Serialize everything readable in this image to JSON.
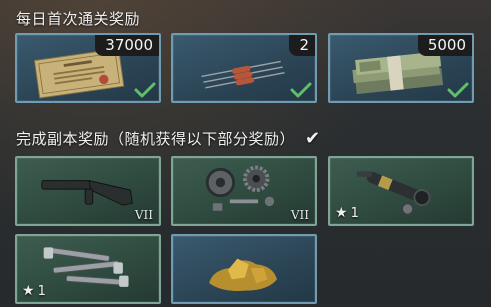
{
  "daily_section": {
    "title": "每日首次通关奖励",
    "rewards": [
      {
        "name": "certificate",
        "count": "37000",
        "claimed": true
      },
      {
        "name": "resistors",
        "count": "2",
        "claimed": true
      },
      {
        "name": "cash-stack",
        "count": "5000",
        "claimed": true
      }
    ]
  },
  "dungeon_section": {
    "title": "完成副本奖励（随机获得以下部分奖励）",
    "rewards": [
      {
        "name": "rifle-stock",
        "tier": "VII"
      },
      {
        "name": "gear-parts",
        "tier": "VII"
      },
      {
        "name": "scope-parts",
        "stars": "1"
      },
      {
        "name": "bolt-set",
        "stars": "1"
      },
      {
        "name": "gold-nugget"
      }
    ]
  },
  "colors": {
    "blue_border": "#6f9bb3",
    "green_border": "#7fa597",
    "check_green": "#5fbf6a"
  }
}
